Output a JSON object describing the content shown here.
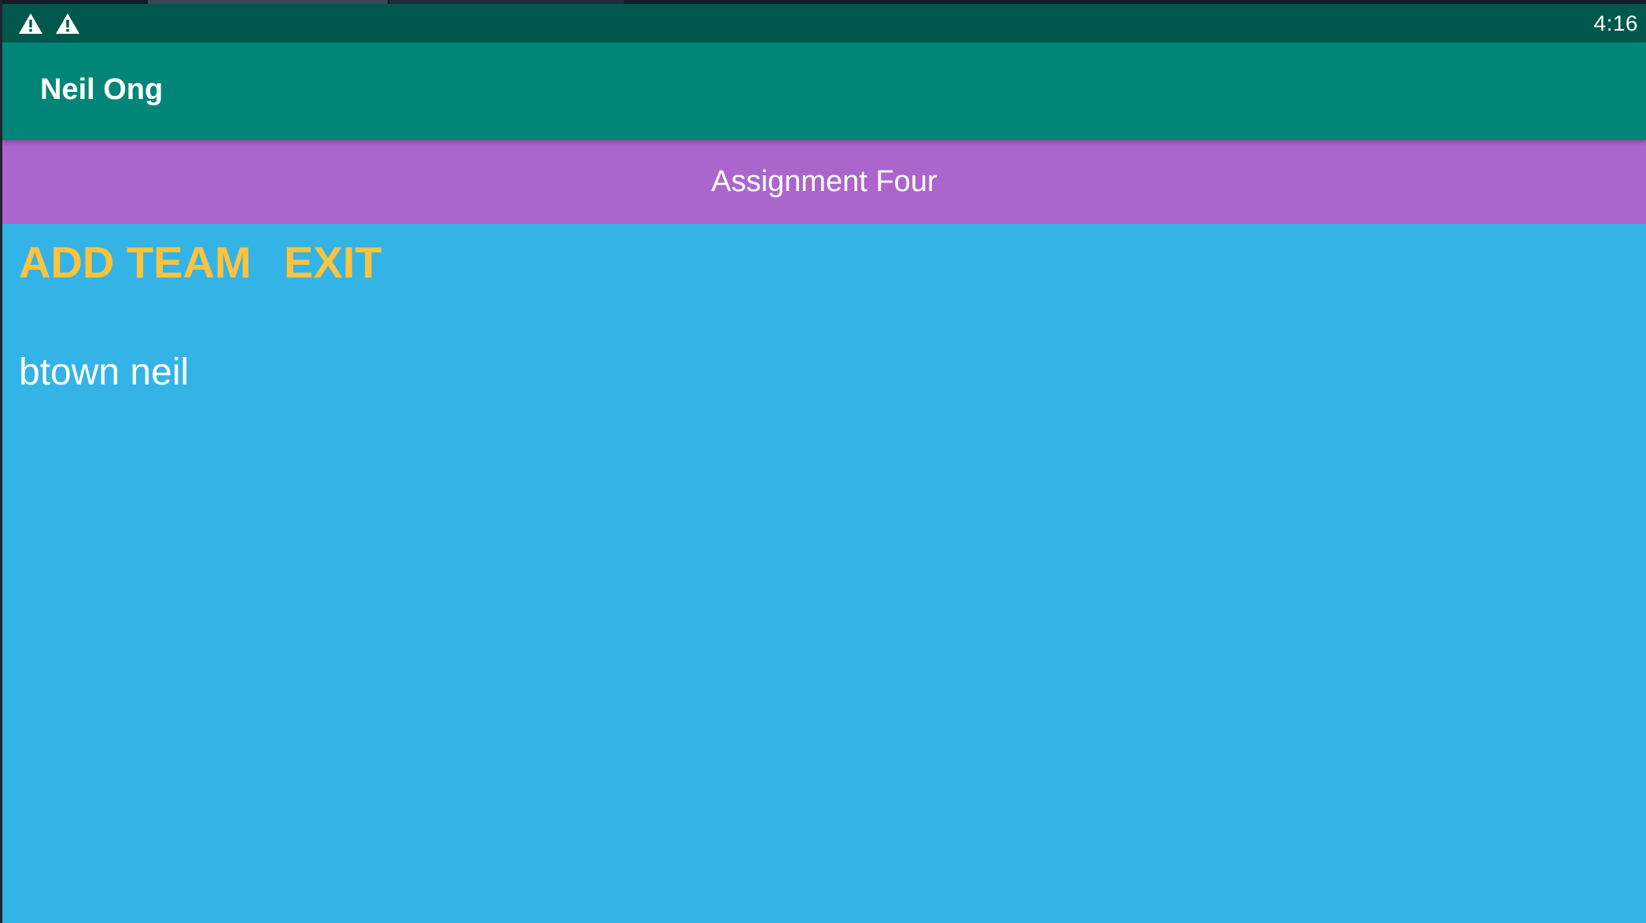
{
  "status_bar": {
    "icons": [
      "warning-icon",
      "warning-icon"
    ],
    "time": "4:16"
  },
  "app_bar": {
    "title": "Neil Ong"
  },
  "banner": {
    "text": "Assignment Four"
  },
  "actions": {
    "add_team_label": "ADD TEAM",
    "exit_label": "EXIT"
  },
  "teams": [
    {
      "name": "btown neil"
    }
  ],
  "colors": {
    "status_bar": "#00574b",
    "app_bar": "#008577",
    "banner": "#aa66cc",
    "background": "#34b4e6",
    "action_text": "#ffc33d",
    "text": "#ffffff"
  }
}
